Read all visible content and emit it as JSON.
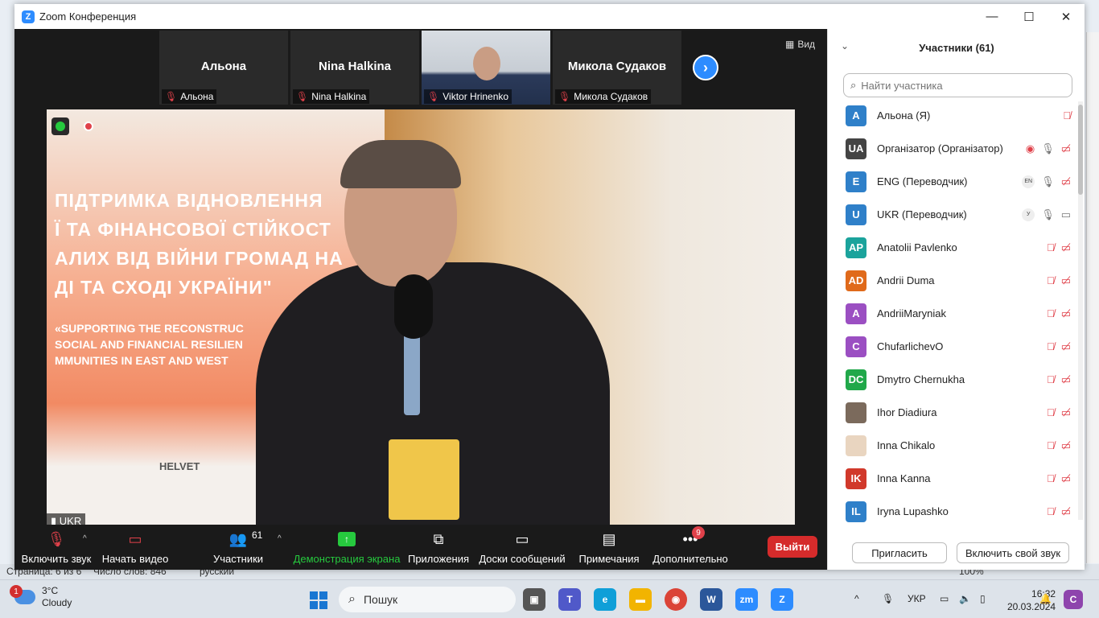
{
  "window": {
    "title": "Zoom Конференция",
    "minimize": "—",
    "maximize": "☐",
    "close": "✕"
  },
  "gallery": {
    "tiles": [
      {
        "big": "Альона",
        "label": "Альона"
      },
      {
        "big": "Nina Halkina",
        "label": "Nina Halkina"
      },
      {
        "big": "",
        "label": "Viktor Hrinenko"
      },
      {
        "big": "Микола Судаков",
        "label": "Микола Судаков"
      }
    ],
    "next": "›",
    "view_label": "Вид"
  },
  "speaker": {
    "banner_lines": [
      "ПІДТРИМКА ВІДНОВЛЕННЯ",
      "Ї ТА ФІНАНСОВОЇ СТІЙКОСТ",
      "АЛИХ ВІД ВІЙНИ ГРОМАД НА",
      "ДІ ТА СХОДІ УКРАЇНИ\""
    ],
    "banner_en": [
      "«SUPPORTING THE RECONSTRUC",
      "SOCIAL AND FINANCIAL RESILIEN",
      "MMUNITIES IN EAST AND WEST"
    ],
    "lower_sign": "HELVET",
    "channel_label": "UKR"
  },
  "toolbar": {
    "audio": "Включить звук",
    "video": "Начать видео",
    "participants": "Участники",
    "participants_count": "61",
    "share": "Демонстрация экрана",
    "apps": "Приложения",
    "boards": "Доски сообщений",
    "notes": "Примечания",
    "more": "Дополнительно",
    "more_badge": "9",
    "exit": "Выйти"
  },
  "panel": {
    "title": "Участники (61)",
    "search_placeholder": "Найти участника",
    "participants": [
      {
        "initials": "A",
        "name": "Альона (Я)",
        "color": "#2f80c9"
      },
      {
        "initials": "UA",
        "name": "Організатор (Організатор)",
        "color": "#444444"
      },
      {
        "initials": "E",
        "name": "ENG (Переводчик)",
        "color": "#2f80c9",
        "lang": "EN"
      },
      {
        "initials": "U",
        "name": "UKR (Переводчик)",
        "color": "#2f80c9",
        "lang": "У"
      },
      {
        "initials": "AP",
        "name": "Anatolii Pavlenko",
        "color": "#1ba39c"
      },
      {
        "initials": "AD",
        "name": "Andrii Duma",
        "color": "#e06a1b"
      },
      {
        "initials": "A",
        "name": "AndriiMaryniak",
        "color": "#9b4fc2"
      },
      {
        "initials": "C",
        "name": "ChufarlichevO",
        "color": "#9b4fc2"
      },
      {
        "initials": "DC",
        "name": "Dmytro Chernukha",
        "color": "#21a84a"
      },
      {
        "initials": "",
        "name": "Ihor Diadiura",
        "color": "#7b6a5c"
      },
      {
        "initials": "",
        "name": "Inna Chikalo",
        "color": "#e9d5c0"
      },
      {
        "initials": "IK",
        "name": "Inna Kanna",
        "color": "#d1392b"
      },
      {
        "initials": "IL",
        "name": "Iryna Lupashko",
        "color": "#2f80c9"
      }
    ],
    "invite": "Пригласить",
    "unmute_self": "Включить свой звук"
  },
  "background_app": {
    "status_page": "Страница: 6 из 6",
    "status_words": "Число слов: 846",
    "status_lang": "русский",
    "zoom_level": "100%"
  },
  "taskbar": {
    "weather_temp": "3°C",
    "weather_desc": "Cloudy",
    "weather_badge": "1",
    "search_label": "Пошук",
    "lang": "УКР",
    "time": "16:32",
    "date": "20.03.2024"
  }
}
